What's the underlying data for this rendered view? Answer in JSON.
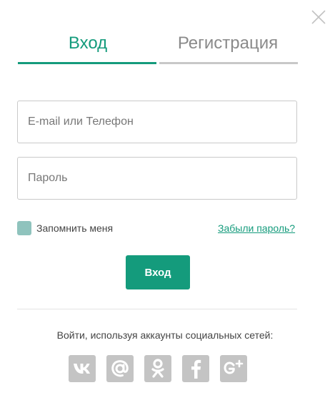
{
  "tabs": {
    "login": "Вход",
    "register": "Регистрация"
  },
  "form": {
    "email_placeholder": "E-mail или Телефон",
    "password_placeholder": "Пароль",
    "remember_label": "Запомнить меня",
    "forgot_link": "Забыли пароль?",
    "submit_label": "Вход"
  },
  "social": {
    "caption": "Войти, используя аккаунты социальных сетей:",
    "icons": [
      "vk-icon",
      "mail-at-icon",
      "odnoklassniki-icon",
      "facebook-icon",
      "google-plus-icon"
    ]
  },
  "colors": {
    "accent": "#149b7c",
    "checkbox": "#8fc3bd",
    "social_bg": "#c4c4c4",
    "inactive_tab": "#8a8a8a"
  }
}
